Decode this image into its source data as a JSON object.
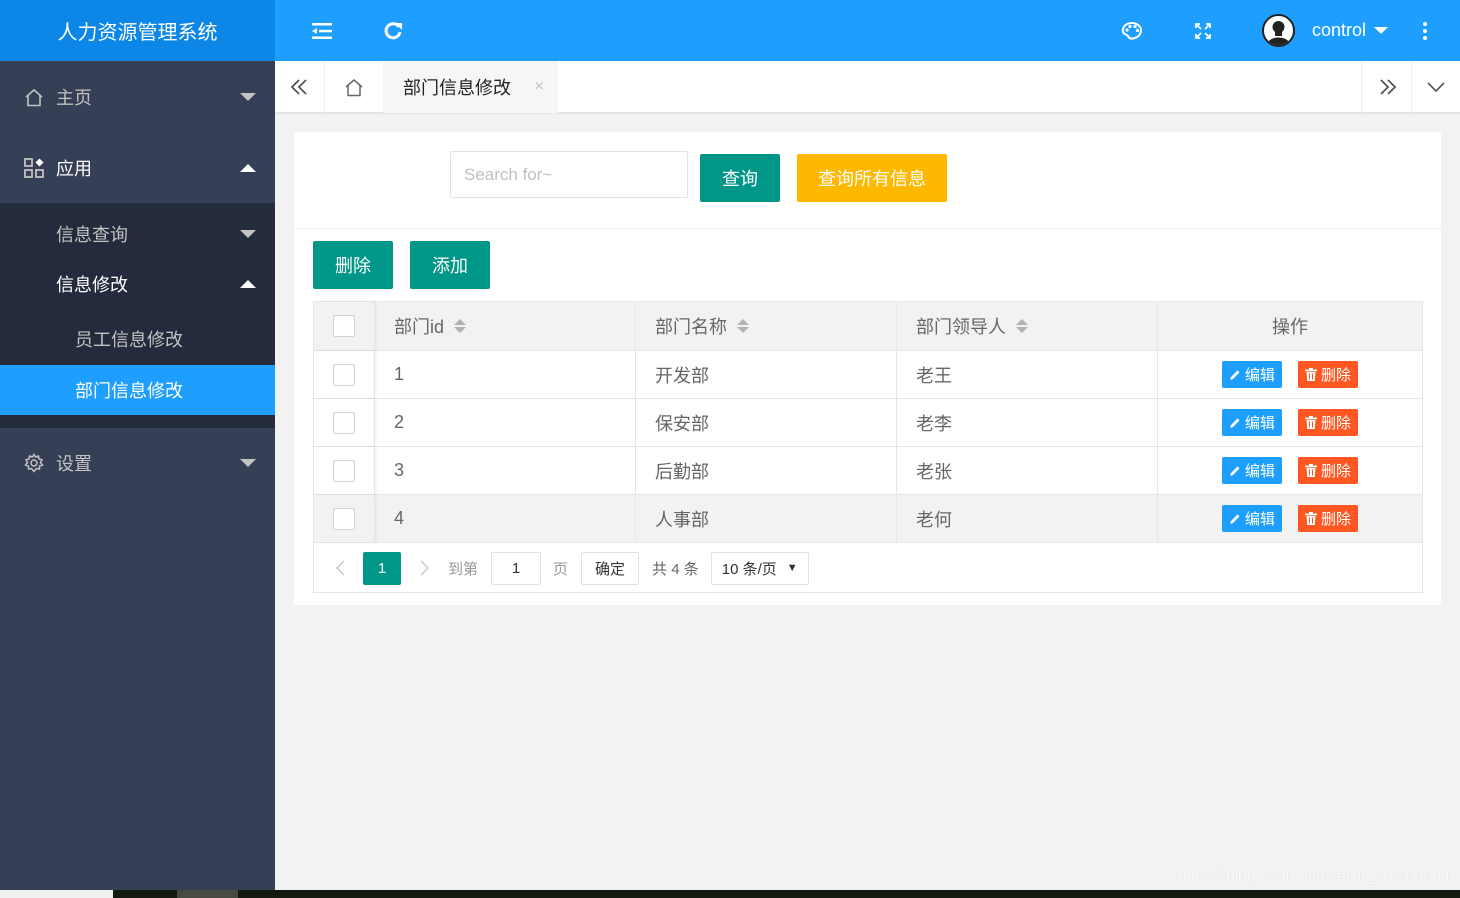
{
  "app": {
    "title": "人力资源管理系统"
  },
  "header": {
    "icons": [
      "menu-fold-icon",
      "refresh-icon",
      "palette-icon",
      "fullscreen-icon",
      "more-vertical-icon"
    ],
    "user": {
      "name": "control"
    }
  },
  "sidebar": {
    "items": [
      {
        "label": "主页",
        "icon": "home-icon",
        "expanded": false
      },
      {
        "label": "应用",
        "icon": "apps-icon",
        "expanded": true
      },
      {
        "label": "设置",
        "icon": "gear-icon",
        "expanded": false
      }
    ],
    "submenu": [
      {
        "label": "信息查询",
        "expanded": false
      },
      {
        "label": "信息修改",
        "expanded": true
      }
    ],
    "subsubmenu": [
      {
        "label": "员工信息修改",
        "active": false
      },
      {
        "label": "部门信息修改",
        "active": true
      }
    ]
  },
  "tabs": {
    "items": [
      {
        "label": "部门信息修改",
        "active": true
      }
    ],
    "close_glyph": "×"
  },
  "search": {
    "placeholder": "Search for~",
    "value": "",
    "query_label": "查询",
    "query_all_label": "查询所有信息"
  },
  "toolbar": {
    "delete_label": "删除",
    "add_label": "添加"
  },
  "table": {
    "columns": [
      "部门id",
      "部门名称",
      "部门领导人",
      "操作"
    ],
    "rows": [
      {
        "id": "1",
        "name": "开发部",
        "leader": "老王"
      },
      {
        "id": "2",
        "name": "保安部",
        "leader": "老李"
      },
      {
        "id": "3",
        "name": "后勤部",
        "leader": "老张"
      },
      {
        "id": "4",
        "name": "人事部",
        "leader": "老何"
      }
    ],
    "edit_label": "编辑",
    "delete_label": "删除"
  },
  "pagination": {
    "current_page": "1",
    "goto_label": "到第",
    "goto_value": "1",
    "page_unit": "页",
    "confirm_label": "确定",
    "total_text": "共 4 条",
    "limit_text": "10 条/页"
  },
  "watermark": "https://blog.csdn.net/weixin_44200984",
  "colors": {
    "primary_blue": "#1e9fff",
    "teal": "#009688",
    "yellow": "#ffb800",
    "danger": "#ff5722",
    "sidebar_bg": "#353f56",
    "sidebar_sub_bg": "#232b3c"
  }
}
